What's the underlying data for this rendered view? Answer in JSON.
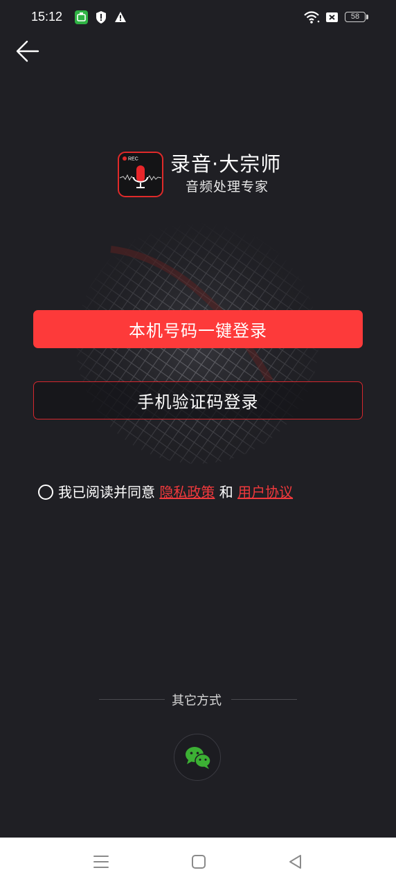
{
  "status_bar": {
    "time": "15:12",
    "battery": "58",
    "icons": [
      "app-badge-icon",
      "shield-icon",
      "warning-icon",
      "wifi-icon",
      "sim-icon",
      "battery-icon"
    ]
  },
  "header": {
    "back_icon": "arrow-left-icon"
  },
  "logo": {
    "rec_label": "REC",
    "title": "录音·大宗师",
    "subtitle": "音频处理专家"
  },
  "login": {
    "one_click_label": "本机号码一键登录",
    "sms_label": "手机验证码登录"
  },
  "agreement": {
    "prefix": "我已阅读并同意",
    "privacy_link": "隐私政策",
    "and": "和",
    "terms_link": "用户协议"
  },
  "other_methods": {
    "label": "其它方式",
    "wechat_icon": "wechat-icon"
  },
  "nav_bar": {
    "icons": [
      "menu-icon",
      "home-icon",
      "back-triangle-icon"
    ]
  },
  "colors": {
    "background": "#1f1f24",
    "accent": "#fd3a3a",
    "link": "#f0393c",
    "wechat": "#3cb034"
  }
}
